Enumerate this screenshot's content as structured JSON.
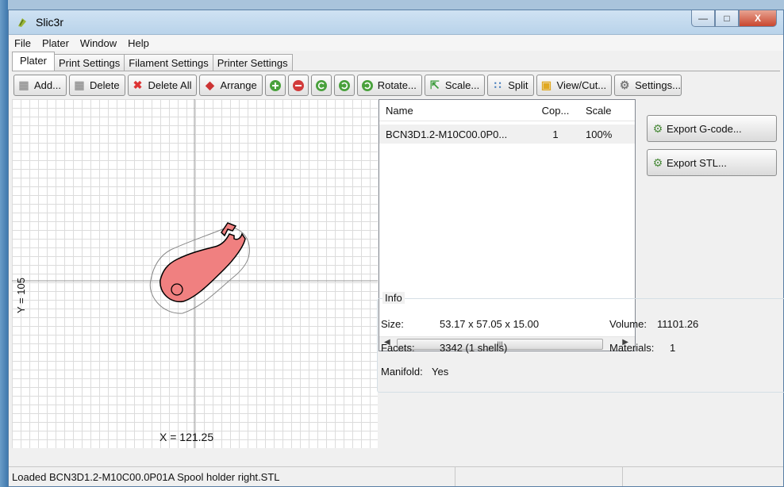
{
  "window": {
    "title": "Slic3r",
    "minimize_label": "—",
    "maximize_label": "□",
    "close_label": "X"
  },
  "menu": [
    "File",
    "Plater",
    "Window",
    "Help"
  ],
  "tabs": [
    "Plater",
    "Print Settings",
    "Filament Settings",
    "Printer Settings"
  ],
  "toolbar": {
    "add": "Add...",
    "delete": "Delete",
    "delete_all": "Delete All",
    "arrange": "Arrange",
    "rotate": "Rotate...",
    "scale": "Scale...",
    "split": "Split",
    "view_cut": "View/Cut...",
    "settings": "Settings..."
  },
  "canvas": {
    "y_label": "Y = 105",
    "x_label": "X = 121.25"
  },
  "object_list": {
    "columns": [
      "Name",
      "Cop...",
      "Scale"
    ],
    "rows": [
      {
        "name": "BCN3D1.2-M10C00.0P0...",
        "copies": "1",
        "scale": "100%"
      }
    ],
    "scroll_thumb": "III"
  },
  "actions": {
    "export_gcode": "Export G-code...",
    "export_stl": "Export STL..."
  },
  "info": {
    "legend": "Info",
    "size_label": "Size:",
    "size_value": "53.17 x 57.05 x 15.00",
    "volume_label": "Volume:",
    "volume_value": "11101.26",
    "facets_label": "Facets:",
    "facets_value": "3342 (1 shells)",
    "materials_label": "Materials:",
    "materials_value": "1",
    "manifold_label": "Manifold:",
    "manifold_value": "Yes"
  },
  "status": {
    "message": "Loaded BCN3D1.2-M10C00.0P01A Spool holder right.STL"
  },
  "colors": {
    "object_fill": "#f08080",
    "accent": "#3f78ad"
  }
}
